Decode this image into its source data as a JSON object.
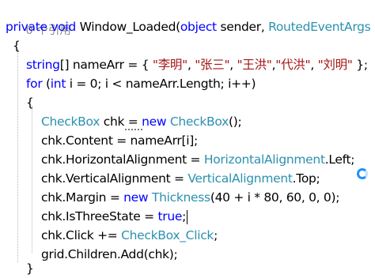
{
  "editor": {
    "ref_count": "0 个引用",
    "sig": {
      "private": "private",
      "void": "void",
      "name": " Window_Loaded(",
      "object": "object",
      "sender": " sender, ",
      "routed": "RoutedEventArgs",
      "e": " e)"
    },
    "brace_open": "{",
    "arr": {
      "string": "string",
      "decl": "[] nameArr = { ",
      "s1": "\"李明\"",
      "s2": "\"张三\"",
      "s3": "\"王洪\"",
      "s4": "\"代洪\"",
      "s5": "\"刘明\"",
      "sep": ", ",
      "sep_tight": ",",
      "end": " };"
    },
    "for": {
      "for_kw": "for",
      "open": " (",
      "int": "int",
      "rest": " i = 0; i < nameArr.Length; i++)"
    },
    "inner_open": "{",
    "chk_decl": {
      "type": "CheckBox",
      "mid": " chk = ",
      "new": "new",
      "sp": " ",
      "type2": "CheckBox",
      "end": "();"
    },
    "content_line": "chk.Content = nameArr[i];",
    "halign": {
      "lhs": "chk.HorizontalAlignment = ",
      "type": "HorizontalAlignment",
      "rhs": ".Left;"
    },
    "valign": {
      "lhs": "chk.VerticalAlignment = ",
      "type": "VerticalAlignment",
      "rhs": ".Top;"
    },
    "margin": {
      "lhs": "chk.Margin = ",
      "new": "new",
      "sp": " ",
      "type": "Thickness",
      "rhs": "(40 + i * 80, 60, 0, 0);"
    },
    "three": {
      "lhs": "chk.IsThreeState = ",
      "true": "true",
      "end": ";"
    },
    "click": {
      "lhs": "chk.Click += ",
      "handler": "CheckBox_Click",
      "end": ";"
    },
    "add": {
      "pre": "grid.Children.",
      "method": "Add",
      "post": "(chk);"
    },
    "inner_close": "}",
    "brace_close": "}"
  }
}
